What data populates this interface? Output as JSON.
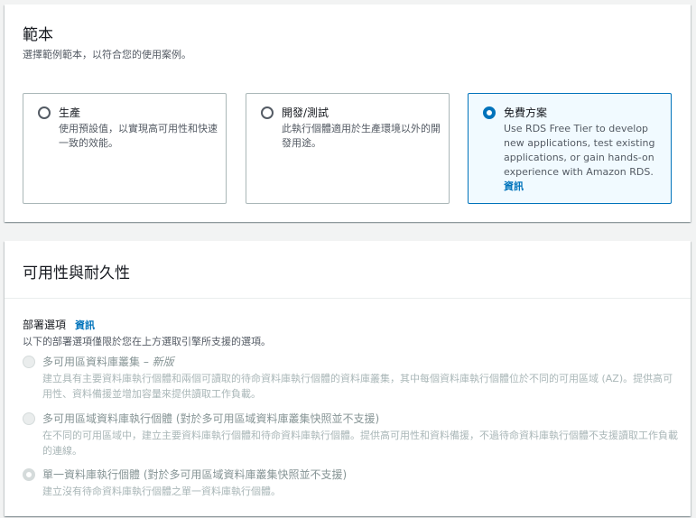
{
  "templates": {
    "title": "範本",
    "description": "選擇範例範本，以符合您的使用案例。",
    "tiles": [
      {
        "label": "生產",
        "description": "使用預設值，以實現高可用性和快速一致的效能。",
        "selected": false
      },
      {
        "label": "開發/測試",
        "description": "此執行個體適用於生產環境以外的開發用途。",
        "selected": false
      },
      {
        "label": "免費方案",
        "description": "Use RDS Free Tier to develop new applications, test existing applications, or gain hands-on experience with Amazon RDS.",
        "info": "資訊",
        "selected": true
      }
    ]
  },
  "availability": {
    "title": "可用性與耐久性",
    "deployment_label": "部署選項",
    "info": "資訊",
    "deployment_description": "以下的部署選項僅限於您在上方選取引擎所支援的選項。",
    "options": [
      {
        "label": "多可用區資料庫叢集",
        "suffix": " – 新版",
        "description": "建立具有主要資料庫執行個體和兩個可讀取的待命資料庫執行個體的資料庫叢集，其中每個資料庫執行個體位於不同的可用區域 (AZ)。提供高可用性、資料備援並增加容量來提供讀取工作負載。",
        "checked": false
      },
      {
        "label": "多可用區域資料庫執行個體 (對於多可用區域資料庫叢集快照並不支援)",
        "suffix": "",
        "description": "在不同的可用區域中，建立主要資料庫執行個體和待命資料庫執行個體。提供高可用性和資料備援，不過待命資料庫執行個體不支援讀取工作負載的連線。",
        "checked": false
      },
      {
        "label": "單一資料庫執行個體 (對於多可用區域資料庫叢集快照並不支援)",
        "suffix": "",
        "description": "建立沒有待命資料庫執行個體之單一資料庫執行個體。",
        "checked": true
      }
    ]
  },
  "colors": {
    "accent": "#0073bb",
    "page_background": "#f2f3f3",
    "disabled_text": "#879596"
  }
}
